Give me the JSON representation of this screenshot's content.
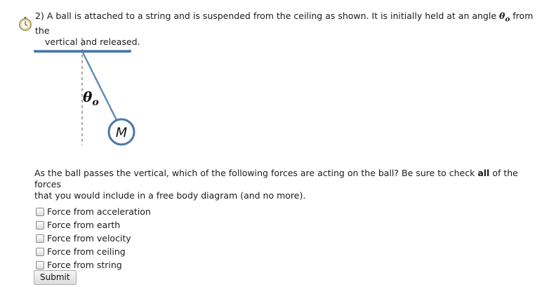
{
  "question": {
    "number": "2)",
    "text_part1": "A ball is attached to a string and is suspended from the ceiling as shown. It is initially held at an angle",
    "theta_symbol": "θ",
    "theta_sub": "o",
    "text_part2": "from the",
    "text_line2": "vertical and released."
  },
  "figure": {
    "angle_label": "θ",
    "angle_sub": "o",
    "ball_label": "M",
    "colors": {
      "ceiling": "#4a76a8",
      "string": "#5b8ab8",
      "ball_border": "#4a76a8",
      "dash": "#555555"
    }
  },
  "prompt": {
    "part1": "As the ball passes the vertical, which of the following forces are acting on the ball? Be sure to check",
    "bold_word": "all",
    "part2": "of the forces",
    "line2": "that you would include in a free body diagram (and no more)."
  },
  "options": [
    {
      "label": "Force from acceleration",
      "checked": false
    },
    {
      "label": "Force from earth",
      "checked": false
    },
    {
      "label": "Force from velocity",
      "checked": false
    },
    {
      "label": "Force from ceiling",
      "checked": false
    },
    {
      "label": "Force from string",
      "checked": false
    }
  ],
  "submit_label": "Submit",
  "icons": {
    "question_icon": "stopwatch-icon"
  }
}
